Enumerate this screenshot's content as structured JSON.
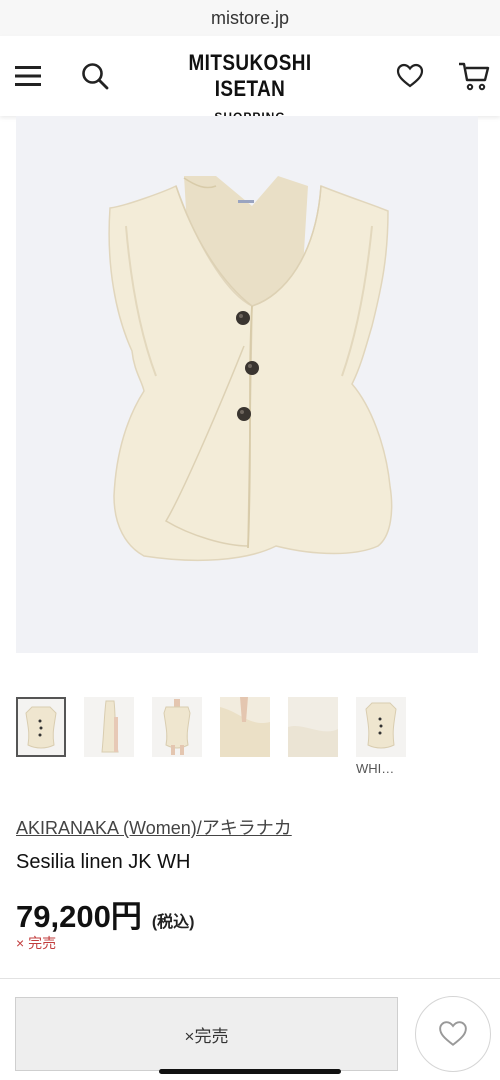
{
  "browser": {
    "url": "mistore.jp"
  },
  "header": {
    "brand": "MITSUKOSHI ISETAN",
    "brand_sub": "SHOPPING",
    "icons": [
      "menu-icon",
      "search-icon",
      "heart-icon",
      "cart-icon"
    ]
  },
  "product": {
    "image_subject": "sleeveless linen vest jacket, cream white, three dark buttons",
    "thumbnails": [
      {
        "name": "front",
        "selected": true
      },
      {
        "name": "side"
      },
      {
        "name": "back"
      },
      {
        "name": "detail-drape"
      },
      {
        "name": "fabric-closeup"
      },
      {
        "name": "front-small",
        "caption": "WHI…"
      }
    ],
    "brand_link": "AKIRANAKA (Women)/アキラナカ",
    "name": "Sesilia linen JK WH",
    "price": "79,200円",
    "tax_note": "(税込)",
    "status_note": "× 完売"
  },
  "footer": {
    "soldout_button": "×完売",
    "favorite_icon": "heart-icon"
  },
  "colors": {
    "hero_bg": "#f1f2f6",
    "garment": "#f3ecd8",
    "soldout_red": "#c23c3c",
    "button_bg": "#eeeeee"
  }
}
